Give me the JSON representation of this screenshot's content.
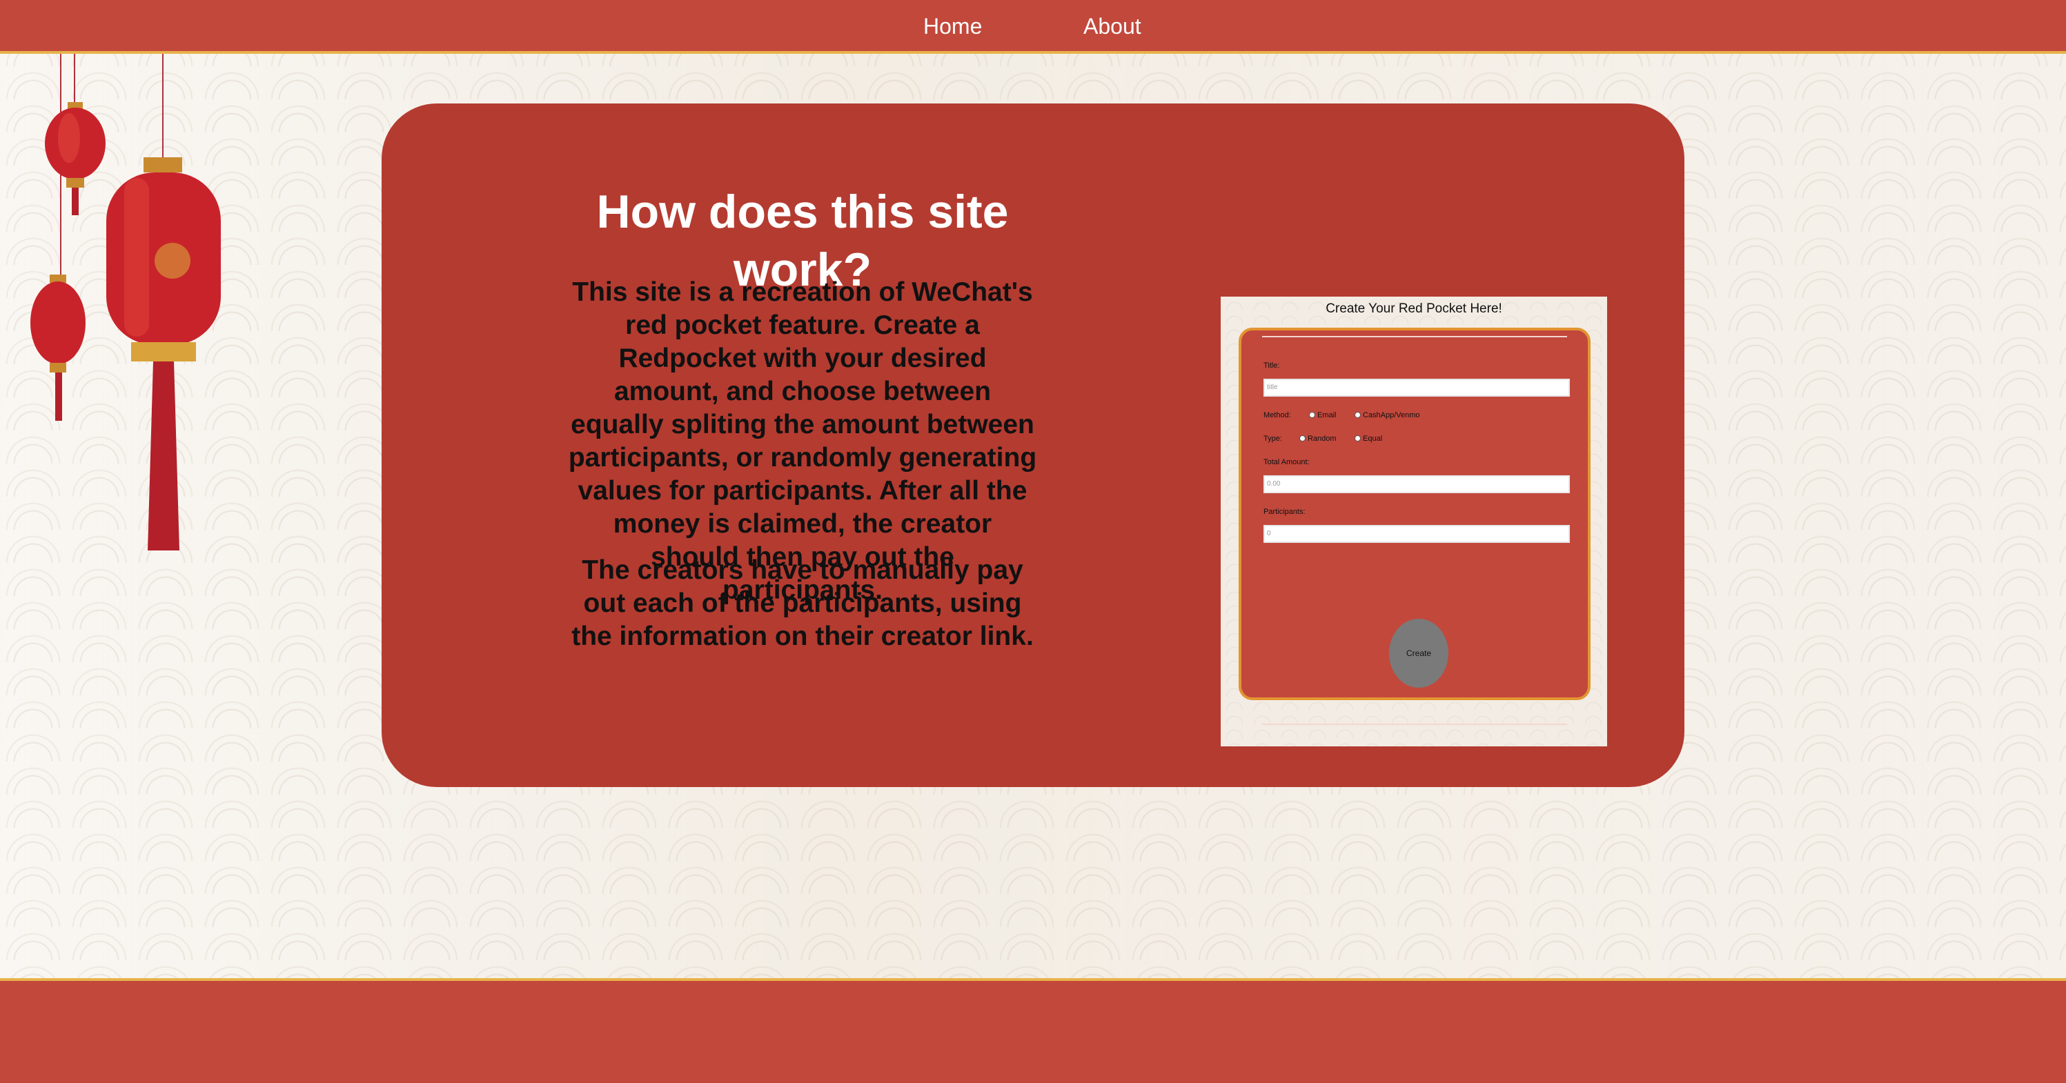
{
  "nav": {
    "home": "Home",
    "about": "About"
  },
  "card": {
    "title": "How does this site work?",
    "paragraph1": "This site is a recreation of WeChat's red pocket feature. Create a Redpocket with your desired amount, and choose between equally spliting the amount between participants, or randomly generating values for participants. After all the money is claimed, the creator should then pay out the participants.",
    "paragraph2": "The creators have to manually pay out each of the participants, using the information on their creator link."
  },
  "preview": {
    "title": "Create Your Red Pocket Here!",
    "title_label": "Title:",
    "title_placeholder": "title",
    "method_label": "Method:",
    "method_options": [
      "Email",
      "CashApp/Venmo"
    ],
    "type_label": "Type:",
    "type_options": [
      "Random",
      "Equal"
    ],
    "amount_label": "Total Amount:",
    "amount_placeholder": "0.00",
    "participants_label": "Participants:",
    "participants_placeholder": "0",
    "create_label": "Create"
  },
  "colors": {
    "nav": "#c2483c",
    "card": "#b43b30",
    "accent": "#e8b24a"
  },
  "icons": {
    "decoration": "red-lanterns"
  }
}
